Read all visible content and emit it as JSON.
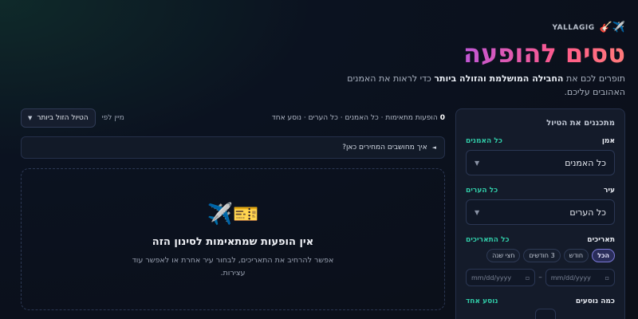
{
  "brand": {
    "name": "YALLAGIG",
    "icons": "✈️🎸"
  },
  "hero": {
    "title": "טסים להופעה",
    "subtitle_prefix": "תופרים לכם את ",
    "subtitle_bold": "החבילה המושלמת והזולה ביותר",
    "subtitle_suffix": " כדי לראות את האמנים האהובים עליכם."
  },
  "sidebar": {
    "title": "מתכננים את הטיול",
    "artist": {
      "label": "אמן",
      "value_hint": "כל האמנים",
      "selected": "כל האמנים"
    },
    "city": {
      "label": "עיר",
      "value_hint": "כל הערים",
      "selected": "כל הערים"
    },
    "dates": {
      "label": "תאריכים",
      "value_hint": "כל התאריכים",
      "chips": [
        "הכל",
        "חודש",
        "3 חודשים",
        "חצי שנה"
      ],
      "from_placeholder": "mm/dd/yyyy",
      "to_placeholder": "mm/dd/yyyy",
      "separator": "–"
    },
    "travelers": {
      "label": "כמה נוסעים",
      "value_hint": "נוסע אחד"
    }
  },
  "toolbar": {
    "count": "0",
    "summary": "הופעות מתאימות · כל האמנים · כל הערים · נוסע אחד",
    "sort_label": "מיין לפי",
    "sort_value": "הטיול הזול ביותר"
  },
  "faq": {
    "text": "איך מחושבים המחירים כאן?"
  },
  "empty": {
    "icons": "✈️🎫",
    "title": "אין הופעות שמתאימות לסינון הזה",
    "description": "אפשר להרחיב את התאריכים, לבחור עיר אחרת או לאפשר עוד עצירות."
  }
}
